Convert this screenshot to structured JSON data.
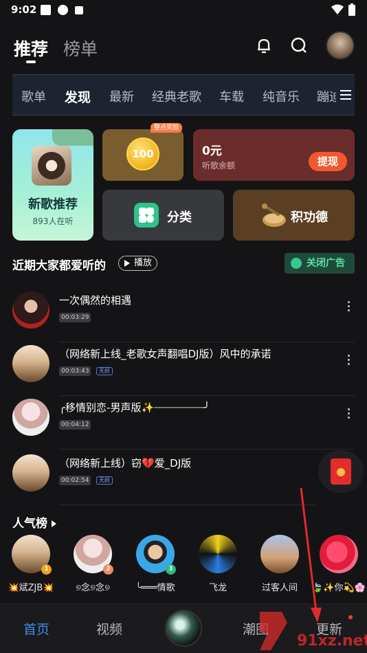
{
  "status_bar": {
    "time": "9:02"
  },
  "header": {
    "tab_recommend": "推荐",
    "tab_charts": "榜单"
  },
  "categories": [
    "歌单",
    "发现",
    "最新",
    "经典老歌",
    "车载",
    "纯音乐",
    "蹦迪"
  ],
  "cards": {
    "new_songs": {
      "title": "新歌推荐",
      "listeners": "893人在听"
    },
    "coins": {
      "value": "100",
      "badge": "整点奖励"
    },
    "balance": {
      "amount": "0元",
      "label": "听歌余额",
      "withdraw": "提现"
    },
    "category": {
      "label": "分类"
    },
    "merit": {
      "label": "积功德"
    }
  },
  "section": {
    "title": "近期大家都爱听的",
    "play": "播放",
    "close_ad": "关闭广告"
  },
  "songs": [
    {
      "title": "一次偶然的相遇",
      "duration": "00:03:29",
      "lossless": ""
    },
    {
      "title": "（网络新上线_老歌女声翻唱DJ版）风中的承诺",
      "duration": "00:03:43",
      "lossless": "无损"
    },
    {
      "title": "╭移情别恋-男声版✨┈┈┈┈┈┈┈┈╯",
      "duration": "00:04:12",
      "lossless": ""
    },
    {
      "title": "（网络新上线）窃💔爱_DJ版",
      "duration": "00:02:54",
      "lossless": "无损"
    }
  ],
  "popularity": {
    "title": "人气榜",
    "artists": [
      {
        "name": "💥斌ZJB💥",
        "rank": "1"
      },
      {
        "name": "୭念୭念୭",
        "rank": "2"
      },
      {
        "name": "╰═══情歌",
        "rank": "3"
      },
      {
        "name": "飞龙",
        "rank": ""
      },
      {
        "name": "过客人间",
        "rank": ""
      },
      {
        "name": "🍃✨你💫🌸",
        "rank": ""
      }
    ]
  },
  "bottom_nav": {
    "home": "首页",
    "video": "视频",
    "trend": "潮图",
    "update": "更新"
  },
  "watermark": {
    "url": "91xz.net"
  },
  "colors": {
    "accent": "#3d8ef0",
    "withdraw": "#f0592f",
    "ad_green": "#59e3a5"
  }
}
